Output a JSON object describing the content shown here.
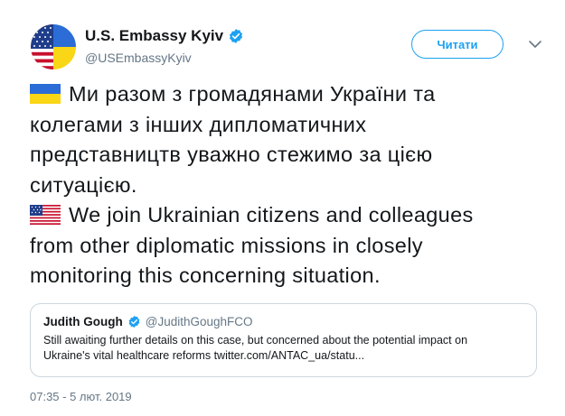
{
  "author": {
    "name": "U.S. Embassy Kyiv",
    "handle": "@USEmbassyKyiv",
    "follow_label": "Читати"
  },
  "tweet": {
    "ua_lines": [
      "Ми разом з громадянами України та",
      "колегами з інших дипломатичних",
      "представництв уважно стежимо за цією",
      "ситуацією."
    ],
    "en_lines": [
      "We join Ukrainian citizens and colleagues",
      "from other diplomatic missions in closely",
      "monitoring this concerning situation."
    ]
  },
  "quoted": {
    "name": "Judith Gough",
    "handle": "@JudithGoughFCO",
    "lines": [
      "Still awaiting further details on this case, but concerned about the potential impact on",
      "Ukraine's vital healthcare reforms twitter.com/ANTAC_ua/statu..."
    ]
  },
  "timestamp": "07:35 - 5 лют. 2019",
  "colors": {
    "accent": "#1da1f2",
    "secondary_text": "#657786",
    "border": "#ccd6dd",
    "ukraine_blue": "#2b6cd6",
    "ukraine_yellow": "#f9d616"
  },
  "icons": {
    "verified": "verified-badge-icon",
    "caret": "chevron-down-icon",
    "flag_ua": "ukraine-flag-icon",
    "flag_us": "us-flag-icon"
  }
}
